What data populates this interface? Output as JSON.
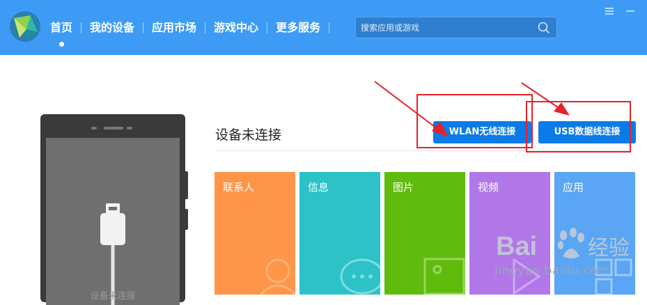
{
  "nav": {
    "items": [
      {
        "label": "首页"
      },
      {
        "label": "我的设备"
      },
      {
        "label": "应用市场"
      },
      {
        "label": "游戏中心"
      },
      {
        "label": "更多服务"
      }
    ]
  },
  "search": {
    "placeholder": "搜索应用或游戏"
  },
  "phone": {
    "status_text": "设备未连接"
  },
  "connect": {
    "title": "设备未连接",
    "wlan_label": "WLAN无线连接",
    "usb_label": "USB数据线连接"
  },
  "tiles": [
    {
      "label": "联系人",
      "color": "#ff9548"
    },
    {
      "label": "信息",
      "color": "#2cc2c7"
    },
    {
      "label": "图片",
      "color": "#5fbb0c"
    },
    {
      "label": "视频",
      "color": "#b177e9"
    },
    {
      "label": "应用",
      "color": "#5aa5f4"
    }
  ],
  "watermark": {
    "brand": "Bai",
    "brand_suffix": "经验",
    "url": "jingyan.baidu.com"
  },
  "colors": {
    "topbar": "#3d9bf6",
    "button": "#0b7be8",
    "annotation": "#e8202a"
  }
}
